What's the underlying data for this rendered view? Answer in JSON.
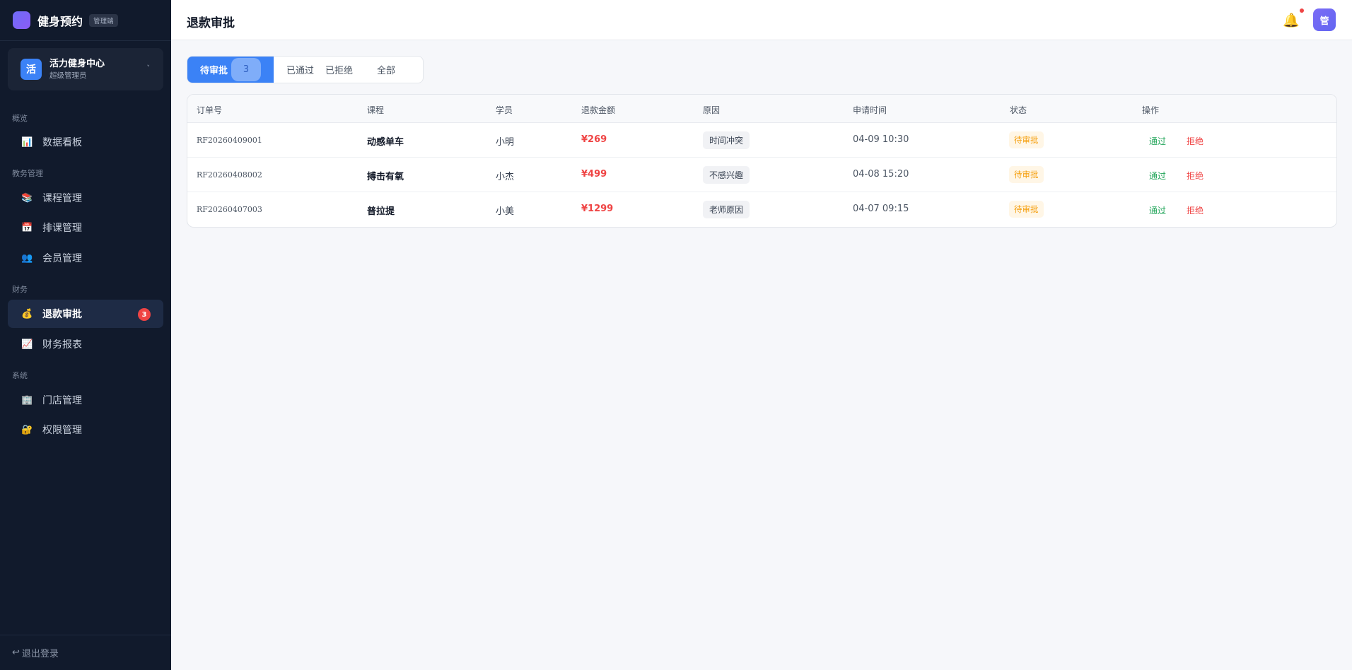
{
  "brand": {
    "name": "健身预约",
    "tag": "管理端"
  },
  "org": {
    "avatar": "活",
    "name": "活力健身中心",
    "role": "超级管理员",
    "caret": "˅"
  },
  "nav": {
    "groups": [
      "概览",
      "教务管理",
      "财务",
      "系统"
    ],
    "items": [
      {
        "icon": "📊",
        "label": "数据看板"
      },
      {
        "icon": "📚",
        "label": "课程管理"
      },
      {
        "icon": "📅",
        "label": "排课管理"
      },
      {
        "icon": "👥",
        "label": "会员管理"
      },
      {
        "icon": "💰",
        "label": "退款审批",
        "badge": "3"
      },
      {
        "icon": "📈",
        "label": "财务报表"
      },
      {
        "icon": "🏢",
        "label": "门店管理"
      },
      {
        "icon": "🔐",
        "label": "权限管理"
      }
    ],
    "logout": {
      "icon": "↩",
      "label": "退出登录"
    }
  },
  "header": {
    "title": "退款审批",
    "bell_icon": "🔔",
    "avatar": "管"
  },
  "tabs": [
    {
      "label": "待审批",
      "count": "3"
    },
    {
      "label": "已通过"
    },
    {
      "label": "已拒绝"
    },
    {
      "label": "全部"
    }
  ],
  "table": {
    "headers": [
      "订单号",
      "课程",
      "学员",
      "退款金额",
      "原因",
      "申请时间",
      "状态",
      "操作"
    ],
    "rows": [
      {
        "order": "RF20260409001",
        "course": "动感单车",
        "student": "小明",
        "amount": "¥269",
        "reason": "时间冲突",
        "time": "04-09 10:30",
        "status": "待审批",
        "approve": "通过",
        "reject": "拒绝"
      },
      {
        "order": "RF20260408002",
        "course": "搏击有氧",
        "student": "小杰",
        "amount": "¥499",
        "reason": "不感兴趣",
        "time": "04-08 15:20",
        "status": "待审批",
        "approve": "通过",
        "reject": "拒绝"
      },
      {
        "order": "RF20260407003",
        "course": "普拉提",
        "student": "小美",
        "amount": "¥1299",
        "reason": "老师原因",
        "time": "04-07 09:15",
        "status": "待审批",
        "approve": "通过",
        "reject": "拒绝"
      }
    ]
  },
  "colors": {
    "sidebar_bg": "#111a2c",
    "accent": "#3b82f6",
    "danger": "#ef4444",
    "success": "#22a55a",
    "warning": "#f59e0b"
  }
}
